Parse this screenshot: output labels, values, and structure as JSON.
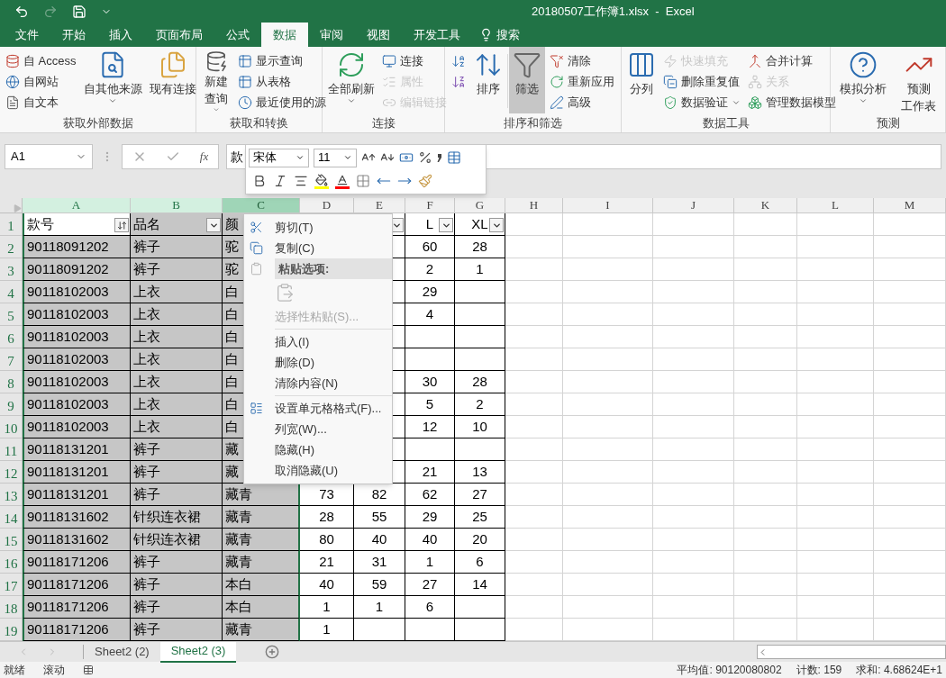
{
  "title_bar": {
    "title": "20180507工作簿1.xlsx  -  Excel",
    "redo_disabled": true
  },
  "menu_tabs": [
    {
      "label": "文件",
      "selected": false
    },
    {
      "label": "开始",
      "selected": false
    },
    {
      "label": "插入",
      "selected": false
    },
    {
      "label": "页面布局",
      "selected": false
    },
    {
      "label": "公式",
      "selected": false
    },
    {
      "label": "数据",
      "selected": true
    },
    {
      "label": "审阅",
      "selected": false
    },
    {
      "label": "视图",
      "selected": false
    },
    {
      "label": "开发工具",
      "selected": false
    }
  ],
  "search": {
    "label": "搜索"
  },
  "ribbon_groups": [
    {
      "label": "获取外部数据",
      "items": [
        {
          "kind": "stack",
          "items": [
            {
              "label": "自 Access",
              "disabled": false
            },
            {
              "label": "自网站",
              "disabled": false
            },
            {
              "label": "自文本",
              "disabled": false
            }
          ]
        },
        {
          "kind": "large",
          "lines": [
            "自其他来源"
          ],
          "dropdown": true,
          "pressed": false
        },
        {
          "kind": "divider"
        },
        {
          "kind": "large",
          "lines": [
            "现有连接"
          ],
          "dropdown": false,
          "pressed": false
        }
      ]
    },
    {
      "label": "获取和转换",
      "items": [
        {
          "kind": "large",
          "lines": [
            "新建",
            "查询"
          ],
          "dropdown": true,
          "pressed": false
        },
        {
          "kind": "stack",
          "items": [
            {
              "label": "显示查询",
              "disabled": false
            },
            {
              "label": "从表格",
              "disabled": false
            },
            {
              "label": "最近使用的源",
              "disabled": false
            }
          ]
        }
      ]
    },
    {
      "label": "连接",
      "items": [
        {
          "kind": "large",
          "lines": [
            "全部刷新"
          ],
          "dropdown": true,
          "pressed": false
        },
        {
          "kind": "stack",
          "items": [
            {
              "label": "连接",
              "disabled": false
            },
            {
              "label": "属性",
              "disabled": true
            },
            {
              "label": "编辑链接",
              "disabled": true
            }
          ]
        }
      ]
    },
    {
      "label": "排序和筛选",
      "items": [
        {
          "kind": "stack",
          "items": [
            {
              "disabled": false
            },
            {
              "disabled": false
            }
          ]
        },
        {
          "kind": "large",
          "lines": [
            "排序"
          ],
          "dropdown": false,
          "pressed": false
        },
        {
          "kind": "divider"
        },
        {
          "kind": "large",
          "lines": [
            "筛选"
          ],
          "dropdown": false,
          "pressed": true
        },
        {
          "kind": "stack",
          "items": [
            {
              "label": "清除",
              "disabled": false
            },
            {
              "label": "重新应用",
              "disabled": false
            },
            {
              "label": "高级",
              "disabled": false
            }
          ]
        }
      ]
    },
    {
      "label": "数据工具",
      "items": [
        {
          "kind": "large",
          "lines": [
            "分列"
          ],
          "dropdown": false,
          "pressed": false
        },
        {
          "kind": "stack",
          "items": [
            {
              "label": "快速填充",
              "disabled": true
            },
            {
              "label": "删除重复值",
              "disabled": false
            },
            {
              "label": "数据验证",
              "disabled": false,
              "dropdown": true
            }
          ]
        },
        {
          "kind": "stack",
          "items": [
            {
              "label": "合并计算",
              "disabled": false
            },
            {
              "label": "关系",
              "disabled": true
            },
            {
              "label": "管理数据模型",
              "disabled": false
            }
          ]
        }
      ]
    },
    {
      "label": "预测",
      "items": [
        {
          "kind": "large",
          "lines": [
            "模拟分析"
          ],
          "dropdown": true,
          "pressed": false
        },
        {
          "kind": "large",
          "lines": [
            "预测",
            "工作表"
          ],
          "dropdown": false,
          "pressed": false
        }
      ]
    }
  ],
  "formula_bar": {
    "name_box": "A1",
    "function_label": "fx",
    "value": "款"
  },
  "mini_toolbar": {
    "font": "宋体",
    "size": "11"
  },
  "columns": [
    {
      "letter": "A",
      "selected": true,
      "hover": false,
      "bordered": true
    },
    {
      "letter": "B",
      "selected": true,
      "hover": false,
      "bordered": true
    },
    {
      "letter": "C",
      "selected": true,
      "hover": true,
      "bordered": true
    },
    {
      "letter": "D",
      "selected": false,
      "hover": false,
      "bordered": true
    },
    {
      "letter": "E",
      "selected": false,
      "hover": false,
      "bordered": true
    },
    {
      "letter": "F",
      "selected": false,
      "hover": false,
      "bordered": true
    },
    {
      "letter": "G",
      "selected": false,
      "hover": false,
      "bordered": true
    },
    {
      "letter": "H",
      "selected": false,
      "hover": false,
      "bordered": false
    },
    {
      "letter": "I",
      "selected": false,
      "hover": false,
      "bordered": false
    },
    {
      "letter": "J",
      "selected": false,
      "hover": false,
      "bordered": false
    },
    {
      "letter": "K",
      "selected": false,
      "hover": false,
      "bordered": false
    },
    {
      "letter": "L",
      "selected": false,
      "hover": false,
      "bordered": false
    },
    {
      "letter": "M",
      "selected": false,
      "hover": false,
      "bordered": false
    }
  ],
  "rows": [
    {
      "header": "1",
      "selected": true,
      "cells": [
        {
          "kind": "sorted_filter",
          "text": "款号",
          "active": true
        },
        {
          "kind": "dropdown_filter",
          "text": "品名",
          "active": false
        },
        {
          "kind": "plain",
          "text": "颜",
          "active": false
        },
        null,
        {
          "kind": "dropdown_filter",
          "active": false
        },
        {
          "kind": "dropdown_filter",
          "text": "L",
          "active": false
        },
        {
          "kind": "dropdown_filter",
          "text": "XL",
          "active": false
        }
      ]
    },
    {
      "header": "2",
      "selected": true,
      "cells": [
        "90118091202",
        "裤子",
        "驼",
        null,
        null,
        "60",
        "28"
      ]
    },
    {
      "header": "3",
      "selected": true,
      "cells": [
        "90118091202",
        "裤子",
        "驼",
        null,
        null,
        "2",
        "1"
      ]
    },
    {
      "header": "4",
      "selected": true,
      "cells": [
        "90118102003",
        "上衣",
        "白",
        null,
        null,
        "29"
      ]
    },
    {
      "header": "5",
      "selected": true,
      "cells": [
        "90118102003",
        "上衣",
        "白",
        null,
        null,
        "4"
      ]
    },
    {
      "header": "6",
      "selected": true,
      "cells": [
        "90118102003",
        "上衣",
        "白"
      ]
    },
    {
      "header": "7",
      "selected": true,
      "cells": [
        "90118102003",
        "上衣",
        "白"
      ]
    },
    {
      "header": "8",
      "selected": true,
      "cells": [
        "90118102003",
        "上衣",
        "白",
        null,
        null,
        "30",
        "28"
      ]
    },
    {
      "header": "9",
      "selected": true,
      "cells": [
        "90118102003",
        "上衣",
        "白",
        null,
        null,
        "5",
        "2"
      ]
    },
    {
      "header": "10",
      "selected": true,
      "cells": [
        "90118102003",
        "上衣",
        "白",
        null,
        null,
        "12",
        "10"
      ]
    },
    {
      "header": "11",
      "selected": true,
      "cells": [
        "90118131201",
        "裤子",
        "藏"
      ]
    },
    {
      "header": "12",
      "selected": true,
      "cells": [
        "90118131201",
        "裤子",
        "藏",
        null,
        null,
        "21",
        "13"
      ]
    },
    {
      "header": "13",
      "selected": true,
      "cells": [
        "90118131201",
        "裤子",
        "藏青",
        "73",
        "82",
        "62",
        "27"
      ]
    },
    {
      "header": "14",
      "selected": true,
      "cells": [
        "90118131602",
        "针织连衣裙",
        "藏青",
        "28",
        "55",
        "29",
        "25"
      ]
    },
    {
      "header": "15",
      "selected": true,
      "cells": [
        "90118131602",
        "针织连衣裙",
        "藏青",
        "80",
        "40",
        "40",
        "20"
      ]
    },
    {
      "header": "16",
      "selected": true,
      "cells": [
        "90118171206",
        "裤子",
        "藏青",
        "21",
        "31",
        "1",
        "6"
      ]
    },
    {
      "header": "17",
      "selected": true,
      "cells": [
        "90118171206",
        "裤子",
        "本白",
        "40",
        "59",
        "27",
        "14"
      ]
    },
    {
      "header": "18",
      "selected": true,
      "cells": [
        "90118171206",
        "裤子",
        "本白",
        "1",
        "1",
        "6"
      ]
    },
    {
      "header": "19",
      "selected": true,
      "cells": [
        "90118171206",
        "裤子",
        "藏青",
        "1"
      ]
    }
  ],
  "context_menu": [
    {
      "kind": "command",
      "label": "剪切(T)",
      "disabled": false
    },
    {
      "kind": "command",
      "label": "复制(C)",
      "disabled": false
    },
    {
      "kind": "heading",
      "label": "粘贴选项:"
    },
    {
      "kind": "paste_icon",
      "disabled": true
    },
    {
      "kind": "command",
      "label": "选择性粘贴(S)...",
      "disabled": true
    },
    {
      "kind": "separator"
    },
    {
      "kind": "command",
      "label": "插入(I)",
      "disabled": false
    },
    {
      "kind": "command",
      "label": "删除(D)",
      "disabled": false
    },
    {
      "kind": "command",
      "label": "清除内容(N)",
      "disabled": false
    },
    {
      "kind": "separator"
    },
    {
      "kind": "command",
      "label": "设置单元格格式(F)...",
      "disabled": false
    },
    {
      "kind": "command",
      "label": "列宽(W)...",
      "disabled": false
    },
    {
      "kind": "command",
      "label": "隐藏(H)",
      "disabled": false
    },
    {
      "kind": "command",
      "label": "取消隐藏(U)",
      "disabled": false
    }
  ],
  "sheet_tabs": [
    {
      "label": "Sheet2 (2)",
      "selected": false
    },
    {
      "label": "Sheet2 (3)",
      "selected": true
    }
  ],
  "status_bar": {
    "left": [
      "就绪",
      "滚动"
    ],
    "right": [
      "平均值: 90120080802",
      "计数: 159",
      "求和: 4.68624E+1"
    ]
  }
}
